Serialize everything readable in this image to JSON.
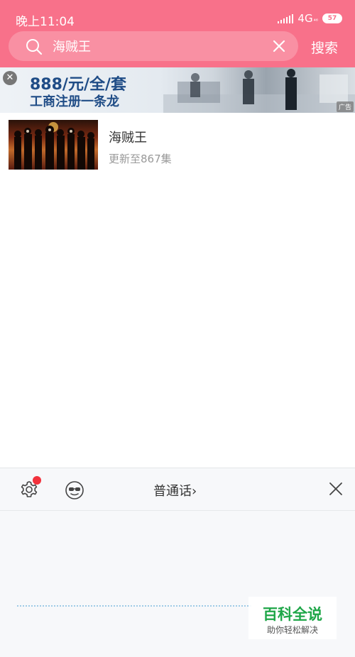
{
  "status_bar": {
    "time": "晚上11:04",
    "network": "4G",
    "network_sub": "⁴⁶",
    "battery": "57"
  },
  "search": {
    "query": "海贼王",
    "button_label": "搜索"
  },
  "ad": {
    "line1": "888/元/全/套",
    "line2": "工商注册一条龙",
    "close_glyph": "✕",
    "badge": "广告"
  },
  "results": [
    {
      "title": "海贼王",
      "subtitle": "更新至867集"
    }
  ],
  "voice_panel": {
    "language": "普通话",
    "language_chevron": "›"
  },
  "watermark": {
    "title": "百科全说",
    "subtitle": "助你轻松解决"
  },
  "colors": {
    "header": "#f8718a",
    "badge_dot": "#f2323c",
    "watermark_green": "#1ea648",
    "ad_text": "#1f4c86"
  }
}
